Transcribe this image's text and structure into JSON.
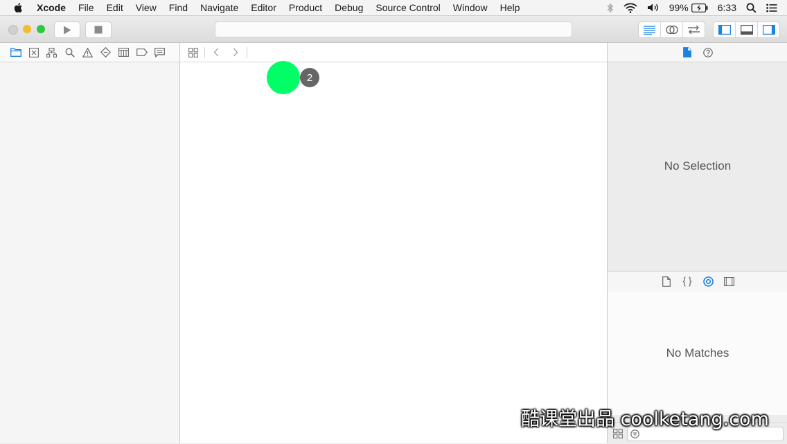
{
  "menubar": {
    "app_name": "Xcode",
    "items": [
      "File",
      "Edit",
      "View",
      "Find",
      "Navigate",
      "Editor",
      "Product",
      "Debug",
      "Source Control",
      "Window",
      "Help"
    ],
    "status": {
      "battery": "99%",
      "time": "6:33"
    }
  },
  "toolbar": {
    "traffic_lights": {
      "close": "#d0d0d0",
      "minimize": "#f5bd2c",
      "zoom": "#2bc840"
    },
    "run_icon": "play-icon",
    "stop_icon": "stop-icon",
    "activity_text": "",
    "editor_modes": [
      "standard-editor-icon",
      "assistant-editor-icon",
      "version-editor-icon"
    ],
    "view_toggles": [
      "navigator-toggle-icon",
      "debug-area-toggle-icon",
      "utilities-toggle-icon"
    ]
  },
  "navigator": {
    "tabs": [
      "folder-icon",
      "source-control-icon",
      "symbol-icon",
      "find-icon",
      "issue-icon",
      "test-icon",
      "debug-icon",
      "breakpoint-icon",
      "report-icon"
    ]
  },
  "editor": {
    "jump_bar_icons": [
      "grid-icon",
      "back-icon",
      "forward-icon"
    ],
    "click_indicator": {
      "count": "2"
    }
  },
  "inspector": {
    "tabs": [
      "file-inspector-icon",
      "quick-help-icon"
    ],
    "empty_text": "No Selection",
    "library": {
      "tabs": [
        "file-template-icon",
        "code-snippet-icon",
        "object-library-icon",
        "media-library-icon"
      ],
      "empty_text": "No Matches",
      "filter_placeholder": ""
    }
  },
  "watermark": "酷课堂出品 coolketang.com",
  "colors": {
    "accent": "#1a82e0",
    "cursor": "#00ff66"
  }
}
